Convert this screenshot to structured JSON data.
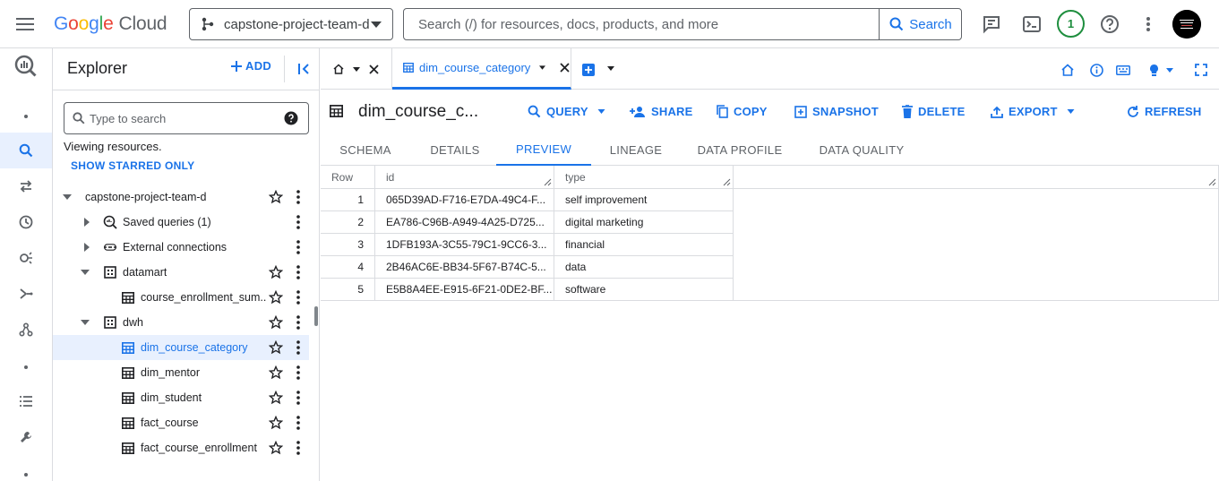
{
  "topbar": {
    "logo": {
      "g": "G",
      "o1": "o",
      "o2": "o",
      "g2": "g",
      "l": "l",
      "e": "e",
      "cloud": "Cloud"
    },
    "project_name": "capstone-project-team-d",
    "search_placeholder": "Search (/) for resources, docs, products, and more",
    "search_button": "Search",
    "notification_count": "1"
  },
  "explorer": {
    "title": "Explorer",
    "add_label": "ADD",
    "search_placeholder": "Type to search",
    "viewing_text": "Viewing resources.",
    "starred_link": "SHOW STARRED ONLY",
    "tree": {
      "project": "capstone-project-team-d",
      "saved_queries": "Saved queries (1)",
      "external_connections": "External connections",
      "datamart": "datamart",
      "datamart_table": "course_enrollment_sum...",
      "dwh": "dwh",
      "dwh_tables": [
        "dim_course_category",
        "dim_mentor",
        "dim_student",
        "fact_course",
        "fact_course_enrollment"
      ]
    }
  },
  "tabs": {
    "active_tab": "dim_course_category"
  },
  "toolbar": {
    "table_title": "dim_course_c...",
    "query": "QUERY",
    "share": "SHARE",
    "copy": "COPY",
    "snapshot": "SNAPSHOT",
    "delete": "DELETE",
    "export": "EXPORT",
    "refresh": "REFRESH"
  },
  "subtabs": [
    "SCHEMA",
    "DETAILS",
    "PREVIEW",
    "LINEAGE",
    "DATA PROFILE",
    "DATA QUALITY"
  ],
  "active_subtab": "PREVIEW",
  "grid": {
    "columns": [
      "Row",
      "id",
      "type"
    ],
    "rows": [
      {
        "row": "1",
        "id": "065D39AD-F716-E7DA-49C4-F...",
        "type": "self improvement"
      },
      {
        "row": "2",
        "id": "EA786-C96B-A949-4A25-D725...",
        "type": "digital marketing"
      },
      {
        "row": "3",
        "id": "1DFB193A-3C55-79C1-9CC6-3...",
        "type": "financial"
      },
      {
        "row": "4",
        "id": "2B46AC6E-BB34-5F67-B74C-5...",
        "type": "data"
      },
      {
        "row": "5",
        "id": "E5B8A4EE-E915-6F21-0DE2-BF...",
        "type": "software"
      }
    ]
  },
  "colors": {
    "accent": "#1a73e8",
    "selected_bg": "#e8f0fe",
    "border": "#dadce0",
    "notification": "#1e8e3e"
  }
}
